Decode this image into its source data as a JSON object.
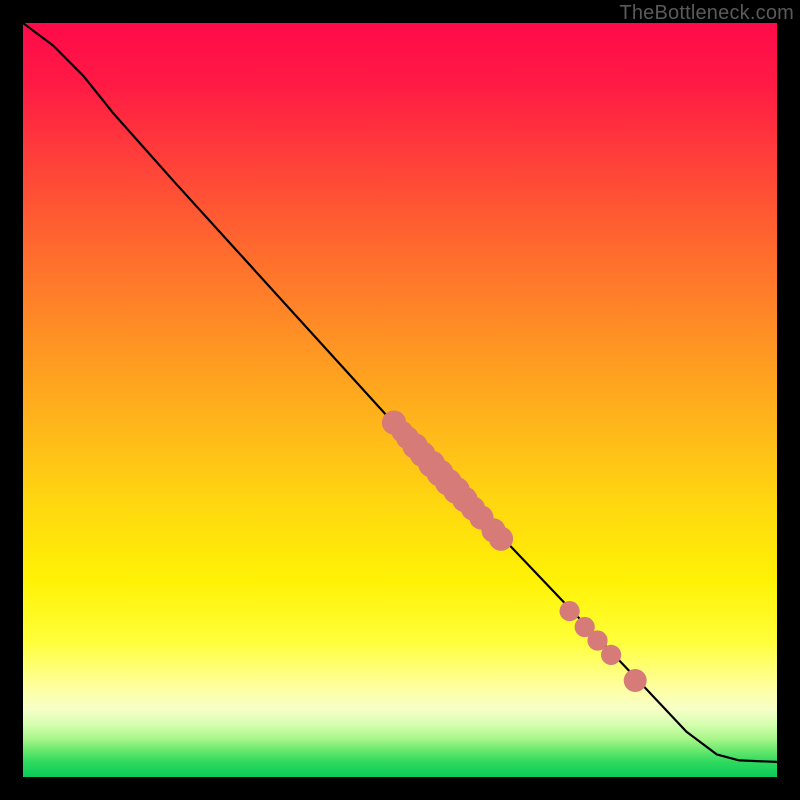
{
  "watermark": "TheBottleneck.com",
  "chart_data": {
    "type": "line",
    "title": "",
    "xlabel": "",
    "ylabel": "",
    "xlim": [
      0,
      100
    ],
    "ylim": [
      0,
      100
    ],
    "curve": [
      {
        "x": 0,
        "y": 100
      },
      {
        "x": 4,
        "y": 97
      },
      {
        "x": 8,
        "y": 93
      },
      {
        "x": 12,
        "y": 88
      },
      {
        "x": 20,
        "y": 79
      },
      {
        "x": 30,
        "y": 68
      },
      {
        "x": 40,
        "y": 57
      },
      {
        "x": 50,
        "y": 46
      },
      {
        "x": 60,
        "y": 35.5
      },
      {
        "x": 70,
        "y": 25
      },
      {
        "x": 80,
        "y": 14.5
      },
      {
        "x": 88,
        "y": 6
      },
      {
        "x": 92,
        "y": 3
      },
      {
        "x": 95,
        "y": 2.2
      },
      {
        "x": 100,
        "y": 2
      }
    ],
    "markers": [
      {
        "x": 49.2,
        "y": 47.0,
        "r": 1.2
      },
      {
        "x": 50.3,
        "y": 45.8,
        "r": 1.0
      },
      {
        "x": 51.0,
        "y": 45.0,
        "r": 1.1
      },
      {
        "x": 52.0,
        "y": 43.9,
        "r": 1.3
      },
      {
        "x": 53.0,
        "y": 42.8,
        "r": 1.3
      },
      {
        "x": 54.2,
        "y": 41.5,
        "r": 1.4
      },
      {
        "x": 55.3,
        "y": 40.3,
        "r": 1.4
      },
      {
        "x": 56.4,
        "y": 39.1,
        "r": 1.4
      },
      {
        "x": 57.5,
        "y": 38.0,
        "r": 1.4
      },
      {
        "x": 58.6,
        "y": 36.8,
        "r": 1.3
      },
      {
        "x": 59.7,
        "y": 35.6,
        "r": 1.2
      },
      {
        "x": 60.8,
        "y": 34.4,
        "r": 1.2
      },
      {
        "x": 62.4,
        "y": 32.7,
        "r": 1.2
      },
      {
        "x": 63.4,
        "y": 31.6,
        "r": 1.2
      },
      {
        "x": 72.5,
        "y": 22.0,
        "r": 0.9
      },
      {
        "x": 74.5,
        "y": 19.9,
        "r": 0.9
      },
      {
        "x": 76.2,
        "y": 18.1,
        "r": 0.9
      },
      {
        "x": 78.0,
        "y": 16.2,
        "r": 0.9
      },
      {
        "x": 81.2,
        "y": 12.8,
        "r": 1.1
      }
    ]
  }
}
